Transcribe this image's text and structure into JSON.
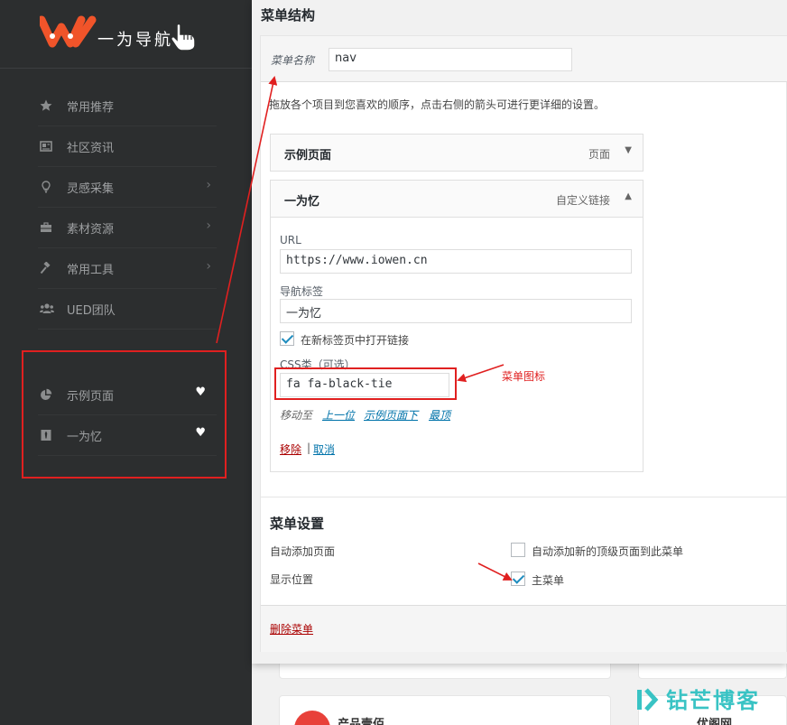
{
  "sidebar": {
    "logo_text": "一为导航",
    "items": [
      {
        "label": "常用推荐",
        "icon": "star-icon",
        "has_submenu": false
      },
      {
        "label": "社区资讯",
        "icon": "newspaper-icon",
        "has_submenu": false
      },
      {
        "label": "灵感采集",
        "icon": "lightbulb-icon",
        "has_submenu": true
      },
      {
        "label": "素材资源",
        "icon": "briefcase-icon",
        "has_submenu": true
      },
      {
        "label": "常用工具",
        "icon": "gavel-icon",
        "has_submenu": true
      },
      {
        "label": "UED团队",
        "icon": "users-icon",
        "has_submenu": false
      }
    ],
    "custom_items": [
      {
        "label": "示例页面",
        "icon": "pie-chart-icon"
      },
      {
        "label": "一为忆",
        "icon": "black-tie-icon"
      }
    ]
  },
  "panel": {
    "title": "菜单结构",
    "menu_name_label": "菜单名称",
    "menu_name_value": "nav",
    "instructions": "拖放各个项目到您喜欢的顺序，点击右侧的箭头可进行更详细的设置。",
    "items": [
      {
        "title": "示例页面",
        "type": "页面",
        "expanded": false
      },
      {
        "title": "一为忆",
        "type": "自定义链接",
        "expanded": true
      }
    ],
    "edit": {
      "url_label": "URL",
      "url_value": "https://www.iowen.cn",
      "nav_label_label": "导航标签",
      "nav_label_value": "一为忆",
      "new_tab_label": "在新标签页中打开链接",
      "new_tab_checked": true,
      "css_label": "CSS类（可选）",
      "css_value": "fa fa-black-tie",
      "move_label": "移动至",
      "move_up": "上一位",
      "move_under": "示例页面下",
      "move_top": "最顶",
      "remove": "移除",
      "separator": "|",
      "cancel": "取消"
    },
    "annotation": "菜单图标",
    "settings": {
      "title": "菜单设置",
      "auto_add_label": "自动添加页面",
      "auto_add_option": "自动添加新的顶级页面到此菜单",
      "auto_add_checked": false,
      "location_label": "显示位置",
      "location_option": "主菜单",
      "location_checked": true
    },
    "delete_menu": "删除菜单"
  },
  "background": {
    "product_name": "产品壹佰",
    "site_name": "优阁网"
  },
  "watermark": "钻芒博客",
  "colors": {
    "sidebar_bg": "#2c2e2f",
    "highlight_red": "#e02020",
    "link_blue": "#0073aa",
    "delete_red": "#a00",
    "logo_orange": "#f0542a",
    "watermark_teal": "#39c3c4"
  }
}
